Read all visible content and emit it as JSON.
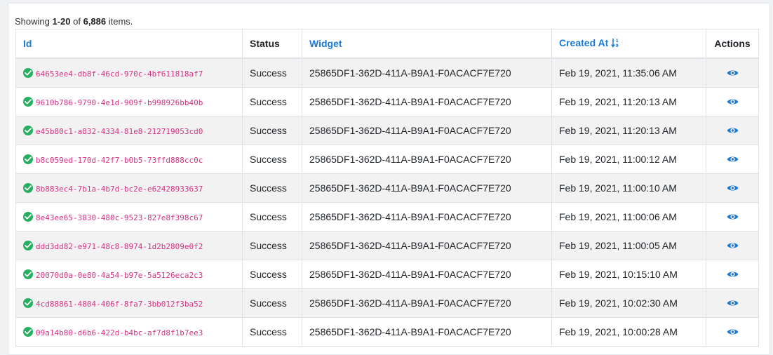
{
  "summary": {
    "prefix": "Showing ",
    "range": "1-20",
    "of": " of ",
    "total": "6,886",
    "suffix": " items."
  },
  "columns": {
    "id": "Id",
    "status": "Status",
    "widget": "Widget",
    "created_at": "Created At",
    "actions": "Actions"
  },
  "colors": {
    "link": "#1a7ad6",
    "id_text": "#d63384",
    "success": "#27ae60"
  },
  "icons": {
    "status": "check-circle-icon",
    "sort": "sort-numeric-down-icon",
    "action": "eye-icon"
  },
  "rows": [
    {
      "id": "64653ee4-db8f-46cd-970c-4bf611818af7",
      "status": "Success",
      "widget": "25865DF1-362D-411A-B9A1-F0ACACF7E720",
      "created_at": "Feb 19, 2021, 11:35:06 AM"
    },
    {
      "id": "9610b786-9790-4e1d-909f-b998926bb40b",
      "status": "Success",
      "widget": "25865DF1-362D-411A-B9A1-F0ACACF7E720",
      "created_at": "Feb 19, 2021, 11:20:13 AM"
    },
    {
      "id": "e45b80c1-a832-4334-81e8-212719053cd0",
      "status": "Success",
      "widget": "25865DF1-362D-411A-B9A1-F0ACACF7E720",
      "created_at": "Feb 19, 2021, 11:20:13 AM"
    },
    {
      "id": "b8c059ed-170d-42f7-b0b5-73ffd888cc0c",
      "status": "Success",
      "widget": "25865DF1-362D-411A-B9A1-F0ACACF7E720",
      "created_at": "Feb 19, 2021, 11:00:12 AM"
    },
    {
      "id": "8b883ec4-7b1a-4b7d-bc2e-e62428933637",
      "status": "Success",
      "widget": "25865DF1-362D-411A-B9A1-F0ACACF7E720",
      "created_at": "Feb 19, 2021, 11:00:10 AM"
    },
    {
      "id": "8e43ee65-3830-480c-9523-827e8f398c67",
      "status": "Success",
      "widget": "25865DF1-362D-411A-B9A1-F0ACACF7E720",
      "created_at": "Feb 19, 2021, 11:00:06 AM"
    },
    {
      "id": "ddd3dd82-e971-48c8-8974-1d2b2809e0f2",
      "status": "Success",
      "widget": "25865DF1-362D-411A-B9A1-F0ACACF7E720",
      "created_at": "Feb 19, 2021, 11:00:05 AM"
    },
    {
      "id": "20070d0a-0e80-4a54-b97e-5a5126eca2c3",
      "status": "Success",
      "widget": "25865DF1-362D-411A-B9A1-F0ACACF7E720",
      "created_at": "Feb 19, 2021, 10:15:10 AM"
    },
    {
      "id": "4cd88861-4804-406f-8fa7-3bb012f3ba52",
      "status": "Success",
      "widget": "25865DF1-362D-411A-B9A1-F0ACACF7E720",
      "created_at": "Feb 19, 2021, 10:02:30 AM"
    },
    {
      "id": "09a14b80-d6b6-422d-b4bc-af7d8f1b7ee3",
      "status": "Success",
      "widget": "25865DF1-362D-411A-B9A1-F0ACACF7E720",
      "created_at": "Feb 19, 2021, 10:00:28 AM"
    }
  ]
}
